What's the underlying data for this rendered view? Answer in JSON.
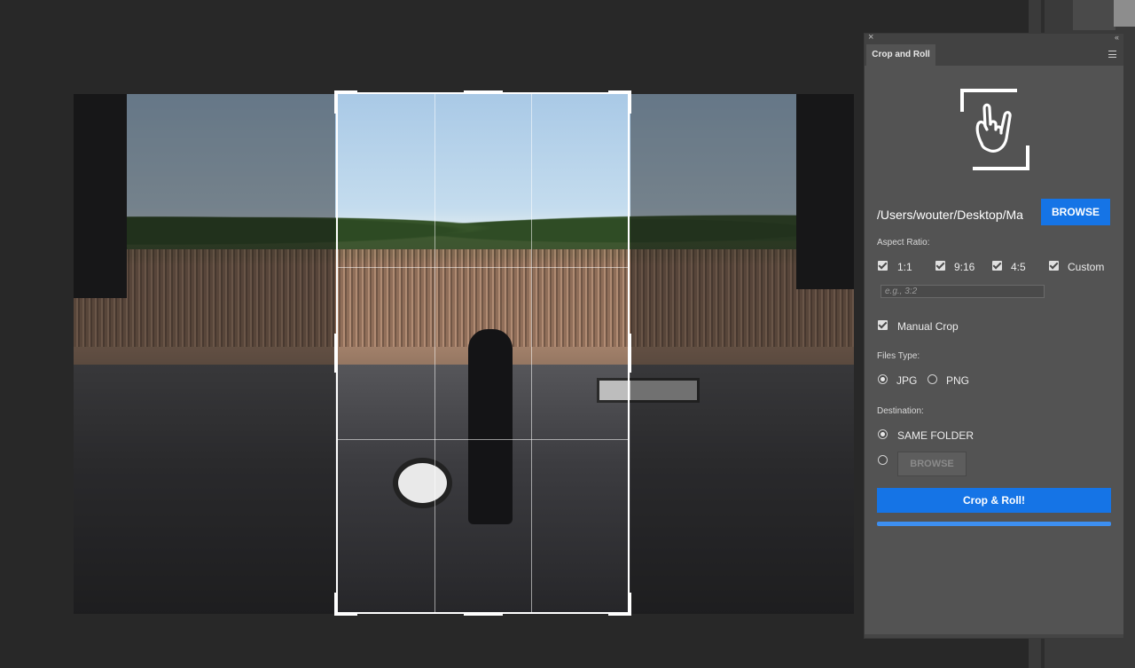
{
  "panel": {
    "tab_title": "Crop and Roll",
    "path_value": "/Users/wouter/Desktop/Ma",
    "browse_label": "BROWSE",
    "aspect_ratio": {
      "label": "Aspect Ratio:",
      "options": [
        {
          "label": "1:1",
          "checked": true
        },
        {
          "label": "9:16",
          "checked": true
        },
        {
          "label": "4:5",
          "checked": true
        },
        {
          "label": "Custom",
          "checked": true
        }
      ],
      "custom_placeholder": "e.g., 3:2"
    },
    "manual_crop": {
      "label": "Manual Crop",
      "checked": true
    },
    "files_type": {
      "label": "Files Type:",
      "options": [
        {
          "label": "JPG",
          "selected": true
        },
        {
          "label": "PNG",
          "selected": false
        }
      ]
    },
    "destination": {
      "label": "Destination:",
      "same_folder_label": "SAME FOLDER",
      "browse_label": "BROWSE"
    },
    "action_label": "Crop & Roll!",
    "progress": 1.0
  },
  "icons": {
    "close": "close-icon",
    "menu": "menu-icon",
    "logo": "rock-hand-crop-icon"
  },
  "colors": {
    "accent": "#1574e6",
    "panel_bg": "#535353",
    "canvas_bg": "#282828"
  }
}
